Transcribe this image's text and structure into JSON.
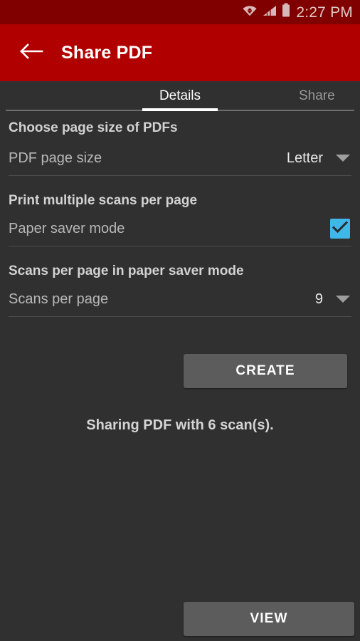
{
  "status_bar": {
    "time": "2:27 PM",
    "icons": [
      "wifi-data-icon",
      "cell-signal-icon",
      "battery-icon"
    ]
  },
  "app_bar": {
    "back_icon": "back-arrow-icon",
    "title": "Share PDF",
    "background_color": "#b00000"
  },
  "tabs": [
    {
      "label": "Details",
      "active": true
    },
    {
      "label": "Share",
      "active": false
    }
  ],
  "sections": [
    {
      "title": "Choose page size of PDFs",
      "row": {
        "label": "PDF page size",
        "value": "Letter",
        "control": "dropdown",
        "caret_icon": "chevron-down-icon"
      }
    },
    {
      "title": "Print multiple scans per page",
      "row": {
        "label": "Paper saver mode",
        "value": "",
        "control": "checkbox",
        "checked": true,
        "check_icon": "checkmark-icon",
        "accent_color": "#3fb7e8"
      }
    },
    {
      "title": "Scans per page in paper saver mode",
      "row": {
        "label": "Scans per page",
        "value": "9",
        "control": "dropdown",
        "caret_icon": "chevron-down-icon"
      }
    }
  ],
  "buttons": {
    "create_label": "CREATE",
    "view_label": "VIEW"
  },
  "status_message": "Sharing PDF with 6 scan(s)."
}
